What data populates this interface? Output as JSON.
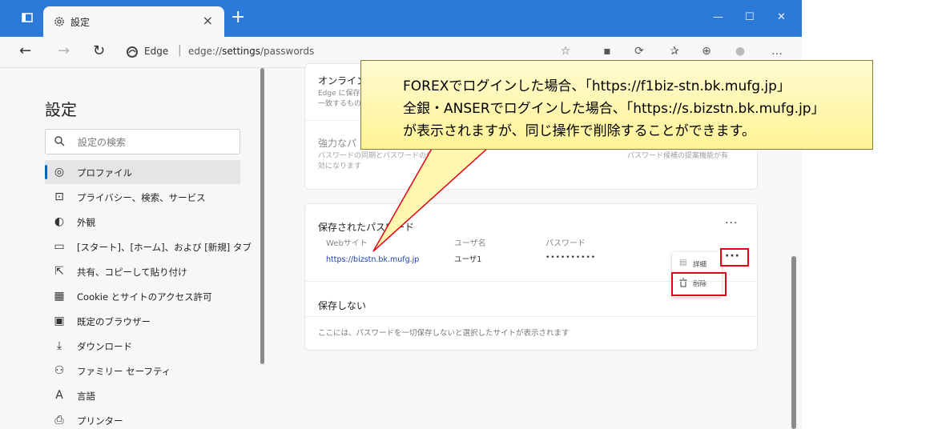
{
  "tab": {
    "title": "設定",
    "close": "×",
    "new": "+"
  },
  "window_controls": {
    "minimize": "—",
    "maximize": "☐",
    "close": "✕"
  },
  "address": {
    "brand": "Edge",
    "separator": "|",
    "url_prefix": "edge://",
    "url_bold": "settings",
    "url_suffix": "/passwords"
  },
  "sidebar": {
    "title": "設定",
    "search_placeholder": "設定の検索",
    "items": [
      {
        "label": "プロファイル",
        "icon": "profile-icon"
      },
      {
        "label": "プライバシー、検索、サービス",
        "icon": "lock-icon"
      },
      {
        "label": "外観",
        "icon": "appearance-icon"
      },
      {
        "label": "[スタート]、[ホーム]、および [新規] タブ",
        "icon": "home-icon"
      },
      {
        "label": "共有、コピーして貼り付け",
        "icon": "share-icon"
      },
      {
        "label": "Cookie とサイトのアクセス許可",
        "icon": "cookie-icon"
      },
      {
        "label": "既定のブラウザー",
        "icon": "browser-icon"
      },
      {
        "label": "ダウンロード",
        "icon": "download-icon"
      },
      {
        "label": "ファミリー セーフティ",
        "icon": "family-icon"
      },
      {
        "label": "言語",
        "icon": "language-icon"
      },
      {
        "label": "プリンター",
        "icon": "printer-icon"
      }
    ]
  },
  "content": {
    "online_title": "オンライン",
    "online_desc_1": "Edge に保存",
    "online_desc_2": "一致するもの",
    "strong_title": "強力なパ",
    "strong_desc_1": "パスワードの同期とパスワードの保存を",
    "strong_desc_1b": "パスワード候補の提案機能が有",
    "strong_desc_2": "効になります",
    "saved_title": "保存されたパスワード",
    "col_site": "Webサイト",
    "col_user": "ユーザ名",
    "col_password": "パスワード",
    "row_site": "https://bizstn.bk.mufg.jp",
    "row_user": "ユーザ1",
    "row_password": "••••••••••",
    "menu_details": "詳細",
    "menu_delete": "削除",
    "never_title": "保存しない",
    "never_desc": "ここには、パスワードを一切保存しないと選択したサイトが表示されます"
  },
  "callout": {
    "line1": "FOREXでログインした場合、「https://f1biz-stn.bk.mufg.jp」",
    "line2": "全銀・ANSERでログインした場合、「https://s.bizstn.bk.mufg.jp」",
    "line3": "が表示されますが、同じ操作で削除することができます。"
  },
  "colors": {
    "titlebar": "#2b7ad8",
    "accent": "#0067c0",
    "highlight": "#e60012",
    "callout_fill": "#fff7b0"
  }
}
